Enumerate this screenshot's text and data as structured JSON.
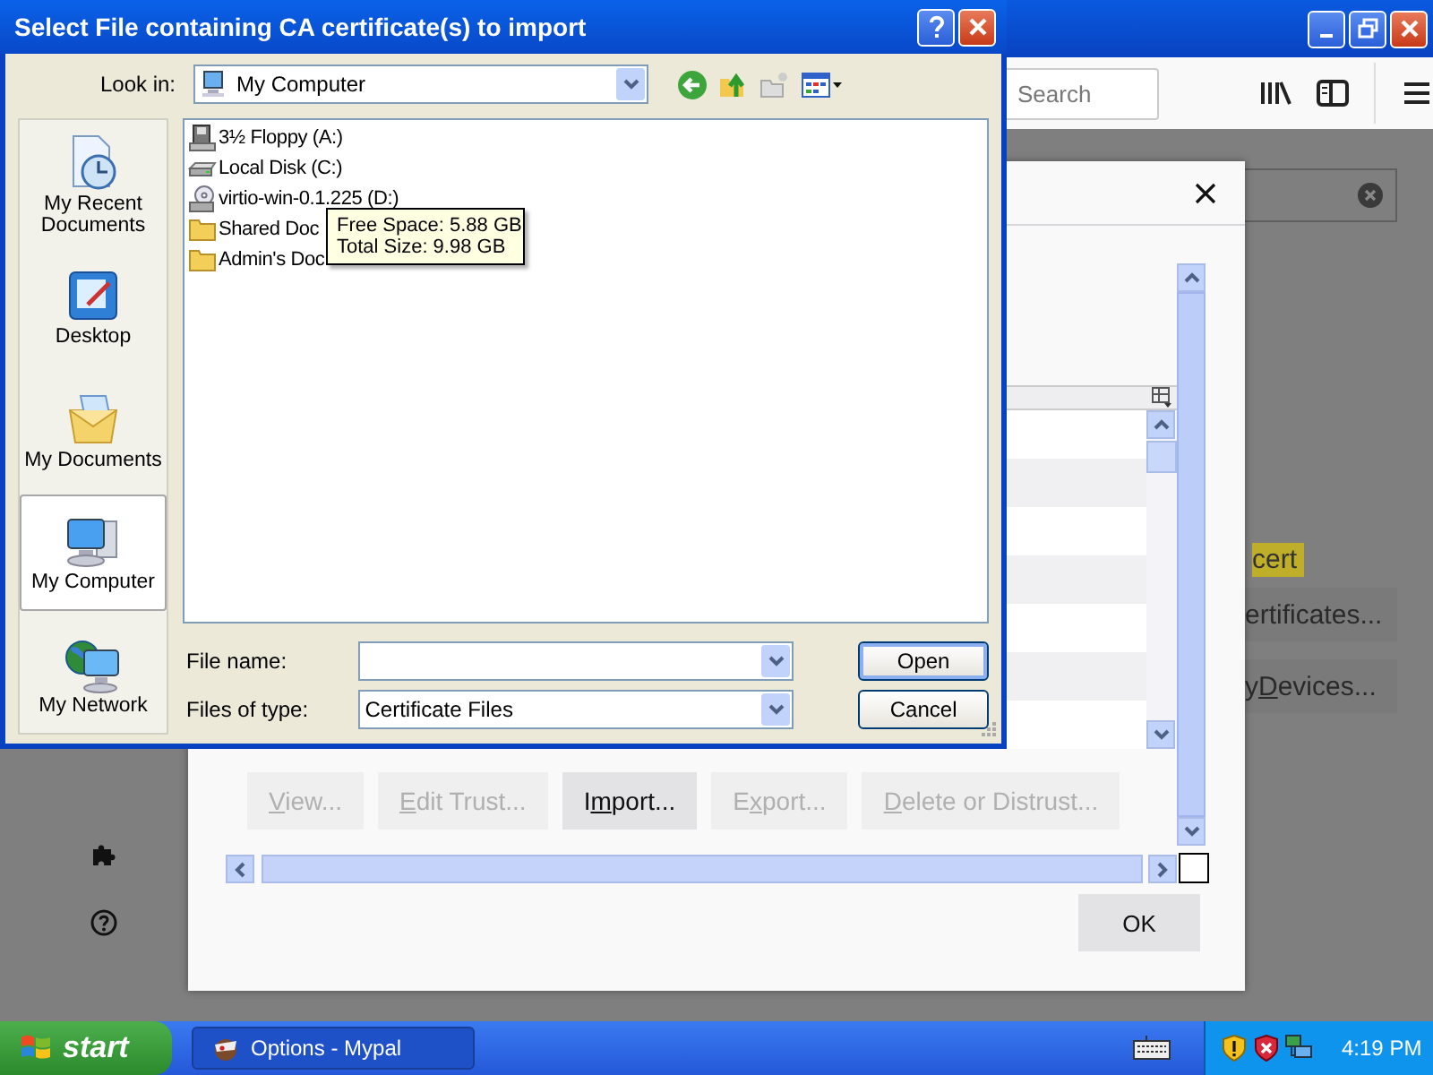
{
  "browser": {
    "search": {
      "placeholder": "Search"
    },
    "highlight": "cert",
    "page_buttons": [
      {
        "label": {
          "post": "ertificates..."
        }
      },
      {
        "label": {
          "pre": "y ",
          "key": "D",
          "post": "evices..."
        }
      }
    ]
  },
  "cert_dialog": {
    "buttons": [
      {
        "label": {
          "key": "V",
          "post": "iew..."
        },
        "disabled": true
      },
      {
        "label": {
          "key": "E",
          "post": "dit Trust..."
        },
        "disabled": true
      },
      {
        "label": {
          "pre": "I",
          "key": "m",
          "post": "port..."
        },
        "disabled": false
      },
      {
        "label": {
          "pre": "E",
          "key": "x",
          "post": "port..."
        },
        "disabled": true
      },
      {
        "label": {
          "key": "D",
          "post": "elete or Distrust..."
        },
        "disabled": true
      }
    ],
    "ok": "OK"
  },
  "file_dialog": {
    "title": "Select File containing CA certificate(s) to import",
    "look_in": {
      "label": "Look in:",
      "value": "My Computer"
    },
    "places": [
      {
        "kind": "recent",
        "label": "My Recent Documents",
        "selected": false
      },
      {
        "kind": "desktop",
        "label": "Desktop",
        "selected": false
      },
      {
        "kind": "documents",
        "label": "My Documents",
        "selected": false
      },
      {
        "kind": "computer",
        "label": "My Computer",
        "selected": true
      },
      {
        "kind": "network",
        "label": "My Network",
        "selected": false
      }
    ],
    "files": [
      {
        "kind": "floppy",
        "name": "3½ Floppy (A:)"
      },
      {
        "kind": "disk",
        "name": "Local Disk (C:)"
      },
      {
        "kind": "cdrom",
        "name": "virtio-win-0.1.225 (D:)"
      },
      {
        "kind": "folder",
        "name": "Shared Doc"
      },
      {
        "kind": "folder",
        "name": "Admin's Doc"
      }
    ],
    "tooltip": [
      "Free Space: 5.88 GB",
      "Total Size: 9.98 GB"
    ],
    "file_name": {
      "label": "File name:"
    },
    "file_type": {
      "label": "Files of type:",
      "value": "Certificate Files"
    },
    "buttons": [
      {
        "label": "Open",
        "default": true
      },
      {
        "label": "Cancel",
        "default": false
      }
    ]
  },
  "taskbar": {
    "start": "start",
    "tasks": [
      {
        "label": "Options - Mypal"
      }
    ],
    "clock": "4:19 PM"
  }
}
